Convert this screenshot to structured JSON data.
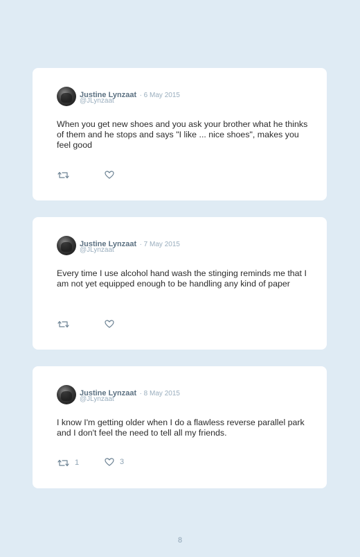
{
  "tweets": [
    {
      "author": "Justine Lynzaat",
      "date": "· 6 May 2015",
      "handle": "@JLynzaat",
      "text": "When you get new shoes and you ask your brother what he thinks of them and he stops and says \"I like ... nice shoes\", makes you feel good",
      "retweet_count": "",
      "like_count": ""
    },
    {
      "author": "Justine Lynzaat",
      "date": "· 7 May 2015",
      "handle": "@JLynzaat",
      "text": "Every time I use alcohol hand wash the stinging reminds me that I am not yet equipped enough to be handling any kind of paper",
      "retweet_count": "",
      "like_count": ""
    },
    {
      "author": "Justine Lynzaat",
      "date": "· 8 May 2015",
      "handle": "@JLynzaat",
      "text": "I know I'm getting older when I do a flawless reverse parallel park and I don't feel the need to tell all my friends.",
      "retweet_count": "1",
      "like_count": "3"
    }
  ],
  "page_number": "8",
  "icons": {
    "retweet": "retweet-icon",
    "like": "heart-icon"
  },
  "colors": {
    "background": "#dfebf4",
    "card": "#ffffff",
    "name": "#5c7182",
    "meta": "#9aaebe"
  }
}
